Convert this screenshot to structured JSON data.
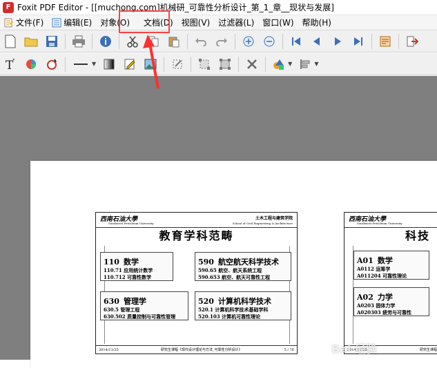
{
  "window": {
    "title": "Foxit PDF Editor - [[muchong.com]机械研_可靠性分析设计_第_1_章__现状与发展]",
    "app_icon_letter": "F"
  },
  "menu": [
    {
      "label": "文件(F)",
      "icon": "file-icon"
    },
    {
      "label": "编辑(E)",
      "icon": "edit-icon"
    },
    {
      "label": "对象(O)",
      "icon": ""
    },
    {
      "label": "文档(D)",
      "icon": ""
    },
    {
      "label": "视图(V)",
      "icon": ""
    },
    {
      "label": "过滤器(L)",
      "icon": ""
    },
    {
      "label": "窗口(W)",
      "icon": ""
    },
    {
      "label": "帮助(H)",
      "icon": ""
    }
  ],
  "slide1": {
    "university": "西南石油大學",
    "university_en": "Southwest Petroleum University",
    "school": "土木工程与建筑学院",
    "school_en": "School of Civil Engineering & Architecture",
    "title": "教育学科范畴",
    "boxes": [
      {
        "code": "110",
        "name": "数学",
        "lines": [
          "110.71  应用统计数学",
          "110.712  可靠性数学"
        ]
      },
      {
        "code": "590",
        "name": "航空航天科学技术",
        "lines": [
          "590.65  航空、航天系统工程",
          "590.653  航空、航天可靠性工程"
        ]
      },
      {
        "code": "630",
        "name": "管理学",
        "lines": [
          "630.5  管理工程",
          "630.502  质量控制与可靠性管理"
        ]
      },
      {
        "code": "520",
        "name": "计算机科学技术",
        "lines": [
          "520.1  计算机科学技术基础学科",
          "520.103  计算机可靠性理论"
        ]
      }
    ],
    "footer_date": "2014/11/25",
    "footer_text": "研究生课程《现代设计理论与方法_可靠性分析设计》",
    "footer_page": "5 / 76"
  },
  "slide2": {
    "university": "西南石油大學",
    "university_en": "Southwest Petroleum University",
    "title": "科技",
    "boxes": [
      {
        "code": "A01",
        "name": "数学",
        "lines": [
          "A0112  运筹学",
          "A011204  可靠性理论"
        ]
      },
      {
        "code": "A02",
        "name": "力学",
        "lines": [
          "A0203  固体力学",
          "A020303  疲劳与可靠性"
        ]
      }
    ],
    "footer_date": "2014/11/25",
    "footer_text": "研究生课程"
  },
  "watermark": "Bai 经验"
}
